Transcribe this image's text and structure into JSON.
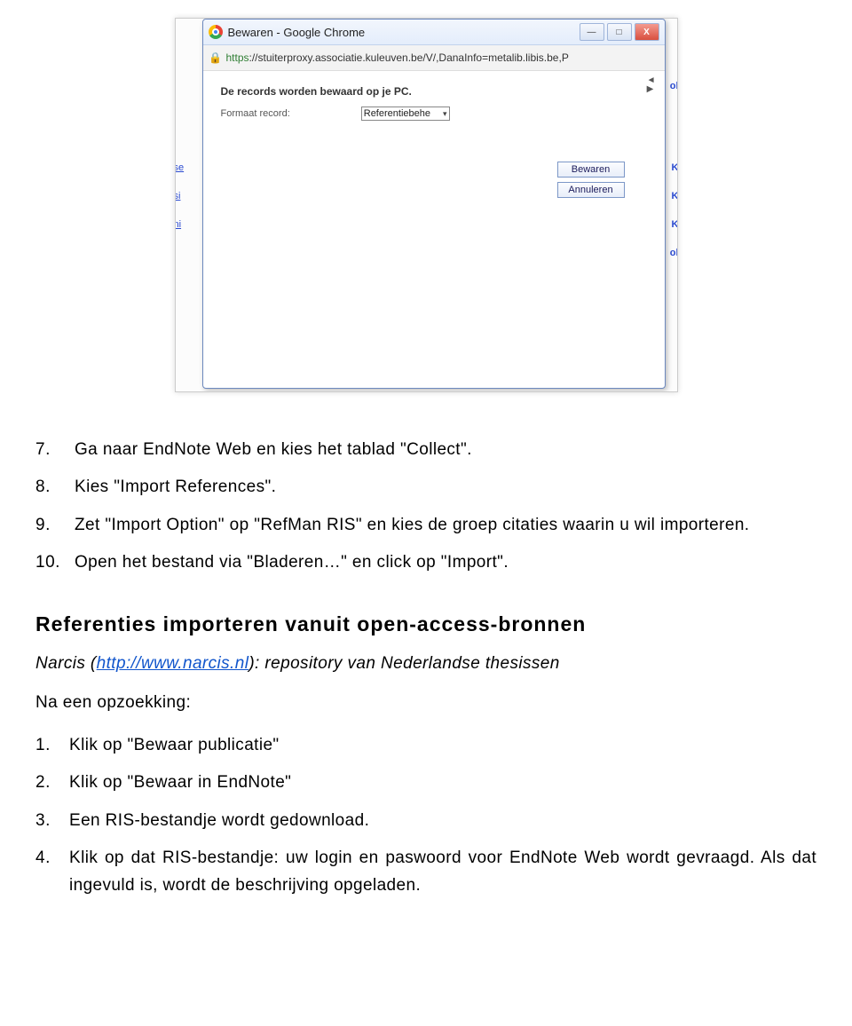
{
  "screenshot": {
    "window_title": "Bewaren - Google Chrome",
    "url_secure_part": "https",
    "url_rest": "://stuiterproxy.associatie.kuleuven.be/V/,DanaInfo=metalib.libis.be,P",
    "msg_bold": "De records worden bewaard op je PC.",
    "label_format": "Formaat record:",
    "select_value": "Referentiebehe",
    "btn_save": "Bewaren",
    "btn_cancel": "Annuleren",
    "bg_right": [
      "ol",
      "K",
      "K",
      "K",
      "ol"
    ],
    "bg_left": [
      "se",
      "si",
      "ni"
    ],
    "nav_left": "◄",
    "nav_right": "▶",
    "min": "—",
    "max": "□",
    "close": "X"
  },
  "list1": [
    {
      "n": "7.",
      "t": "Ga naar EndNote Web en kies het tablad \"Collect\"."
    },
    {
      "n": "8.",
      "t": "Kies \"Import References\"."
    },
    {
      "n": "9.",
      "t": "Zet \"Import Option\" op \"RefMan RIS\" en kies de groep citaties waarin u wil importeren."
    },
    {
      "n": "10.",
      "t": "Open het bestand via \"Bladeren…\" en click op \"Import\"."
    }
  ],
  "heading": "Referenties importeren vanuit open-access-bronnen",
  "narcis_pre": "Narcis (",
  "narcis_link": "http://www.narcis.nl",
  "narcis_post": "): repository van Nederlandse thesissen",
  "after_search": "Na een opzoekking:",
  "list2": [
    {
      "n": "1.",
      "t": "Klik op \"Bewaar publicatie\""
    },
    {
      "n": "2.",
      "t": "Klik op \"Bewaar in EndNote\""
    },
    {
      "n": "3.",
      "t": "Een RIS-bestandje wordt gedownload."
    },
    {
      "n": "4.",
      "t": "Klik op dat RIS-bestandje: uw login en paswoord voor EndNote Web wordt gevraagd. Als dat ingevuld is, wordt de beschrijving opgeladen."
    }
  ]
}
